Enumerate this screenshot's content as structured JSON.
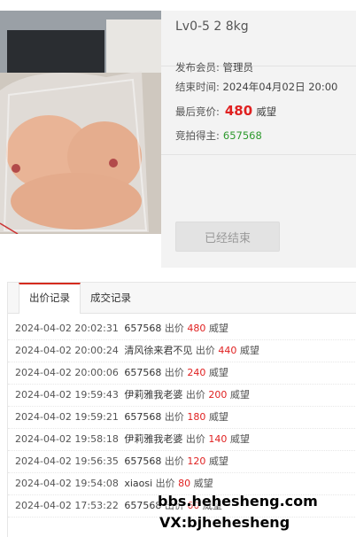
{
  "product": {
    "title": "Lv0-5 2 8kg",
    "publisher_label": "发布会员:",
    "publisher_value": "管理员",
    "end_label": "结束时间:",
    "end_value": "2024年04月02日 20:00",
    "price_label": "最后竞价:",
    "price_value": "480",
    "price_unit": "威望",
    "winner_label": "竞拍得主:",
    "winner_value": "657568",
    "status_button": "已经结束"
  },
  "tabs": [
    {
      "label": "出价记录",
      "active": true
    },
    {
      "label": "成交记录",
      "active": false
    }
  ],
  "bids": [
    {
      "time": "2024-04-02 20:02:31",
      "user": "657568",
      "action": "出价",
      "amount": "480",
      "unit": "威望"
    },
    {
      "time": "2024-04-02 20:00:24",
      "user": "清风徐来君不见",
      "action": "出价",
      "amount": "440",
      "unit": "威望"
    },
    {
      "time": "2024-04-02 20:00:06",
      "user": "657568",
      "action": "出价",
      "amount": "240",
      "unit": "威望"
    },
    {
      "time": "2024-04-02 19:59:43",
      "user": "伊莉雅我老婆",
      "action": "出价",
      "amount": "200",
      "unit": "威望"
    },
    {
      "time": "2024-04-02 19:59:21",
      "user": "657568",
      "action": "出价",
      "amount": "180",
      "unit": "威望"
    },
    {
      "time": "2024-04-02 19:58:18",
      "user": "伊莉雅我老婆",
      "action": "出价",
      "amount": "140",
      "unit": "威望"
    },
    {
      "time": "2024-04-02 19:56:35",
      "user": "657568",
      "action": "出价",
      "amount": "120",
      "unit": "威望"
    },
    {
      "time": "2024-04-02 19:54:08",
      "user": "xiaosi",
      "action": "出价",
      "amount": "80",
      "unit": "威望"
    },
    {
      "time": "2024-04-02 17:53:22",
      "user": "657568",
      "action": "出价",
      "amount": "60",
      "unit": "威望"
    }
  ],
  "watermark": {
    "line1": "bbs.hehesheng.com",
    "line2": "VX:bjhehesheng"
  },
  "colors": {
    "accent_red": "#e02121",
    "winner_green": "#2f9a2f",
    "tab_active_border": "#d52b1e"
  }
}
